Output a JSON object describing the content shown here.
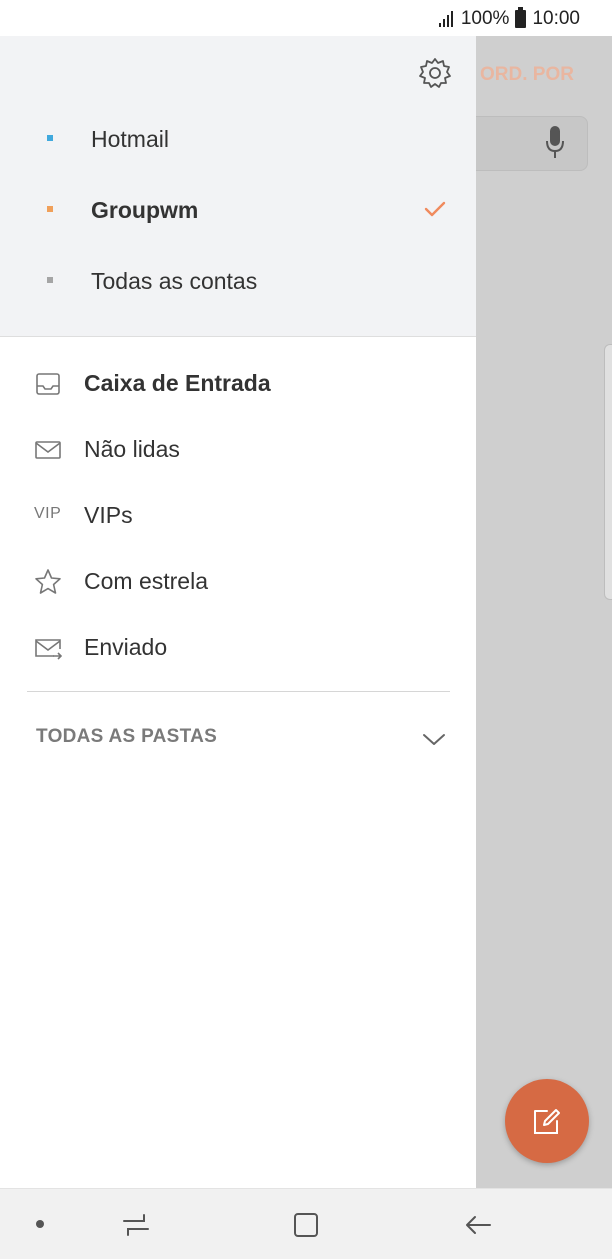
{
  "status_bar": {
    "battery": "100%",
    "time": "10:00"
  },
  "background": {
    "sort_label": "ORD. POR"
  },
  "drawer": {
    "accounts": [
      {
        "label": "Hotmail",
        "color": "#41a9dd",
        "bold": false,
        "selected": false
      },
      {
        "label": "Groupwm",
        "color": "#f0a05a",
        "bold": true,
        "selected": true
      },
      {
        "label": "Todas as contas",
        "color": "#a5a5a5",
        "bold": false,
        "selected": false
      }
    ],
    "folders": [
      {
        "label": "Caixa de Entrada",
        "icon": "inbox-icon"
      },
      {
        "label": "Não lidas",
        "icon": "envelope-icon"
      },
      {
        "label": "VIPs",
        "icon": "vip-icon",
        "icon_text": "VIP"
      },
      {
        "label": "Com estrela",
        "icon": "star-icon"
      },
      {
        "label": "Enviado",
        "icon": "sent-icon"
      }
    ],
    "all_folders_label": "TODAS AS PASTAS"
  },
  "colors": {
    "accent": "#d66a44",
    "check": "#f08a5d"
  }
}
